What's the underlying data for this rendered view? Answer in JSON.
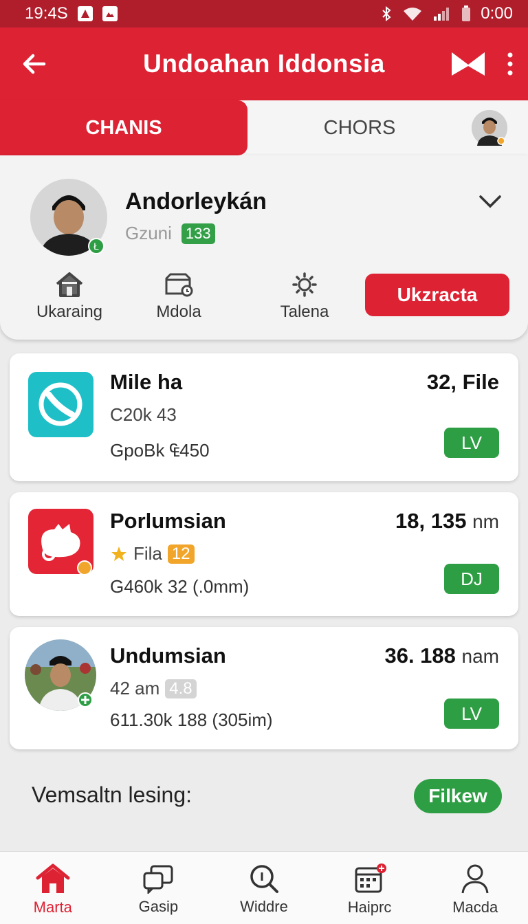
{
  "status_bar": {
    "time": "19:4S",
    "right_time": "0:00"
  },
  "app_bar": {
    "title": "Undoahan Iddonsia"
  },
  "tabs": [
    {
      "label": "CHANIS",
      "active": true
    },
    {
      "label": "CHORS",
      "active": false
    }
  ],
  "profile": {
    "name": "Andorleykán",
    "subtitle": "Gzuni",
    "badge": "133",
    "online_badge": "Ł"
  },
  "quick_actions": [
    {
      "label": "Ukaraing",
      "icon": "home-icon"
    },
    {
      "label": "Mdola",
      "icon": "box-icon"
    },
    {
      "label": "Talena",
      "icon": "settings-icon"
    }
  ],
  "primary_button": "Ukzracta",
  "cards": [
    {
      "title": "Mile ha",
      "value": "32, File",
      "unit": "",
      "line2": "C20k  43",
      "line3": "GpoBk  ₠450",
      "pill": "LV",
      "icon": "phone-app-icon",
      "color": "#1fbfc8"
    },
    {
      "title": "Porlumsian",
      "value": "18, 135",
      "unit": "nm",
      "line2_label": "Fila",
      "line2_badge": "12",
      "line3": "G460k  32 (.0mm)",
      "pill": "DJ",
      "icon": "cat-app-icon",
      "color": "#e42535"
    },
    {
      "title": "Undumsian",
      "value": "36. 188",
      "unit": "nam",
      "line2": "42 am",
      "line2_badge": "4.8",
      "line3": "611.30k 188 (305im)",
      "pill": "LV",
      "icon": "user-photo-icon"
    }
  ],
  "footer": {
    "label": "Vemsaltn lesing:",
    "button": "Filkew"
  },
  "bottom_nav": [
    {
      "label": "Marta",
      "icon": "home-icon",
      "active": true
    },
    {
      "label": "Gasip",
      "icon": "chat-icon",
      "active": false
    },
    {
      "label": "Widdre",
      "icon": "search-icon",
      "active": false
    },
    {
      "label": "Haiprc",
      "icon": "calendar-icon",
      "active": false
    },
    {
      "label": "Macda",
      "icon": "profile-icon",
      "active": false
    }
  ],
  "colors": {
    "primary": "#dd2233",
    "success": "#2e9e44",
    "accent": "#f1a52a"
  }
}
